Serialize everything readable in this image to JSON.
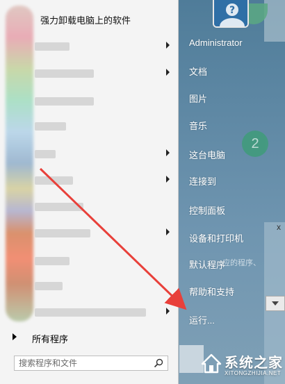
{
  "start_menu": {
    "top_program_label": "强力卸载电脑上的软件",
    "all_programs": "所有程序",
    "search": {
      "placeholder": "搜索程序和文件",
      "value": ""
    }
  },
  "right_pane": {
    "links": [
      "Administrator",
      "文档",
      "图片",
      "音乐",
      "这台电脑",
      "连接到",
      "控制面板",
      "设备和打印机",
      "默认程序",
      "帮助和支持",
      "运行..."
    ]
  },
  "background": {
    "faded_hint": "应的程序、",
    "circle_number": "2",
    "close_glyph": "x"
  },
  "watermark": {
    "brand": "系统之家",
    "url": "XITONGZHIJIA.NET"
  },
  "colors": {
    "arrow": "#e8403a",
    "menu_bg": "#f4f4f4",
    "desktop": "#6f95b0"
  }
}
